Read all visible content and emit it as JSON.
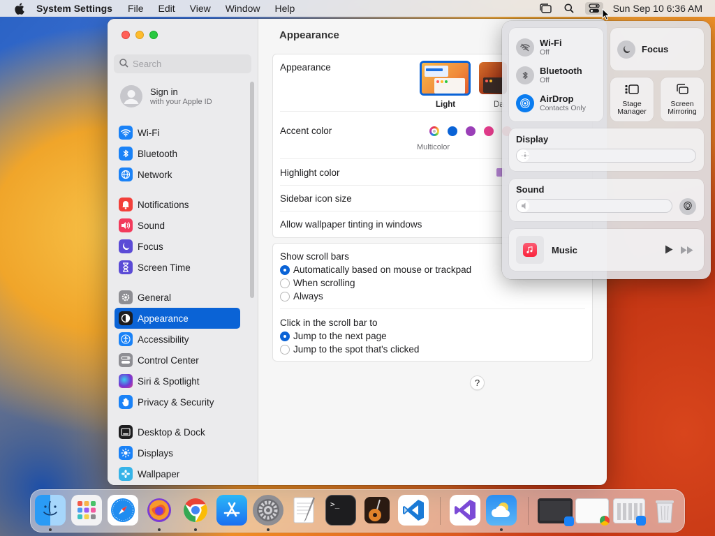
{
  "menubar": {
    "app_name": "System Settings",
    "menus": [
      "File",
      "Edit",
      "View",
      "Window",
      "Help"
    ],
    "clock": "Sun Sep 10  6:36 AM"
  },
  "sidebar": {
    "search_placeholder": "Search",
    "apple_id": {
      "title": "Sign in",
      "subtitle": "with your Apple ID"
    },
    "items": [
      {
        "label": "Wi-Fi",
        "icon": "wifi-icon",
        "color": "#1a82f7"
      },
      {
        "label": "Bluetooth",
        "icon": "bluetooth-icon",
        "color": "#1a82f7"
      },
      {
        "label": "Network",
        "icon": "globe-icon",
        "color": "#1a82f7"
      },
      {
        "label": "Notifications",
        "icon": "bell-icon",
        "color": "#f2403b"
      },
      {
        "label": "Sound",
        "icon": "speaker-icon",
        "color": "#f23b5c"
      },
      {
        "label": "Focus",
        "icon": "moon-icon",
        "color": "#5b4bd6"
      },
      {
        "label": "Screen Time",
        "icon": "hourglass-icon",
        "color": "#5b4bd6"
      },
      {
        "label": "General",
        "icon": "gear-icon",
        "color": "#8e8e93"
      },
      {
        "label": "Appearance",
        "icon": "appearance-icon",
        "color": "#1d1d1f"
      },
      {
        "label": "Accessibility",
        "icon": "accessibility-icon",
        "color": "#1a82f7"
      },
      {
        "label": "Control Center",
        "icon": "control-center-icon",
        "color": "#8e8e93"
      },
      {
        "label": "Siri & Spotlight",
        "icon": "siri-icon",
        "color": "#c73bd6"
      },
      {
        "label": "Privacy & Security",
        "icon": "hand-icon",
        "color": "#1a82f7"
      },
      {
        "label": "Desktop & Dock",
        "icon": "dock-icon",
        "color": "#1d1d1f"
      },
      {
        "label": "Displays",
        "icon": "sun-icon",
        "color": "#1a82f7"
      },
      {
        "label": "Wallpaper",
        "icon": "flower-icon",
        "color": "#36b3e8"
      }
    ]
  },
  "content": {
    "title": "Appearance",
    "appearance_label": "Appearance",
    "appearance_light": "Light",
    "appearance_dark_partial": "Da",
    "accent_label": "Accent color",
    "accent_selected": "Multicolor",
    "accent_colors": [
      "#0a63d6",
      "#9a3fb7",
      "#e43c8c",
      "#e8363b"
    ],
    "highlight_label": "Highlight color",
    "highlight_color": "#b785d6",
    "sidebar_icon_label": "Sidebar icon size",
    "tint_label": "Allow wallpaper tinting in windows",
    "scrollbars_label": "Show scroll bars",
    "scrollbar_options": [
      "Automatically based on mouse or trackpad",
      "When scrolling",
      "Always"
    ],
    "click_label": "Click in the scroll bar to",
    "click_options": [
      "Jump to the next page",
      "Jump to the spot that's clicked"
    ],
    "help": "?"
  },
  "control_center": {
    "wifi": {
      "title": "Wi-Fi",
      "status": "Off"
    },
    "bluetooth": {
      "title": "Bluetooth",
      "status": "Off"
    },
    "airdrop": {
      "title": "AirDrop",
      "status": "Contacts Only"
    },
    "focus": "Focus",
    "stage_manager": [
      "Stage",
      "Manager"
    ],
    "screen_mirroring": [
      "Screen",
      "Mirroring"
    ],
    "display": "Display",
    "sound": "Sound",
    "music": "Music"
  },
  "dock": {
    "apps": [
      "finder-icon",
      "launchpad-icon",
      "safari-icon",
      "firefox-icon",
      "chrome-icon",
      "app-store-icon",
      "system-settings-icon",
      "textedit-icon",
      "terminal-icon",
      "garageband-icon",
      "vscode-icon",
      "visual-studio-icon",
      "weather-icon"
    ]
  }
}
